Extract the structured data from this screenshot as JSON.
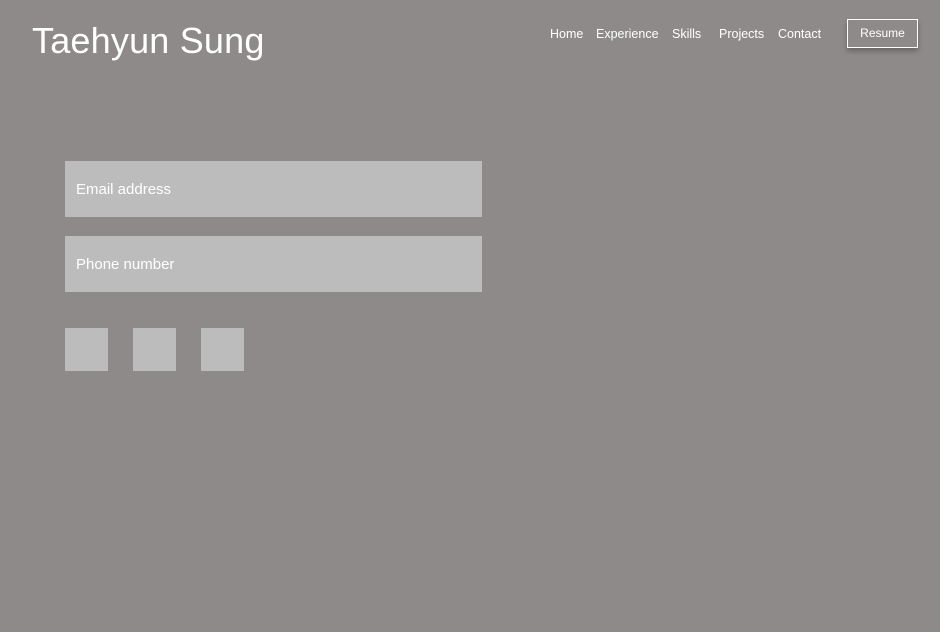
{
  "header": {
    "title": "Taehyun Sung",
    "nav": {
      "home": "Home",
      "experience": "Experience",
      "skills": "Skills",
      "projects": "Projects",
      "contact": "Contact"
    },
    "resume_label": "Resume"
  },
  "contact_form": {
    "email": {
      "placeholder": "Email address",
      "value": ""
    },
    "phone": {
      "placeholder": "Phone number",
      "value": ""
    }
  },
  "social_links": [
    {
      "icon": "social-icon-placeholder"
    },
    {
      "icon": "social-icon-placeholder"
    },
    {
      "icon": "social-icon-placeholder"
    }
  ],
  "colors": {
    "background": "#8f8a8a",
    "field": "#bdbcbc",
    "text": "#ffffff"
  }
}
